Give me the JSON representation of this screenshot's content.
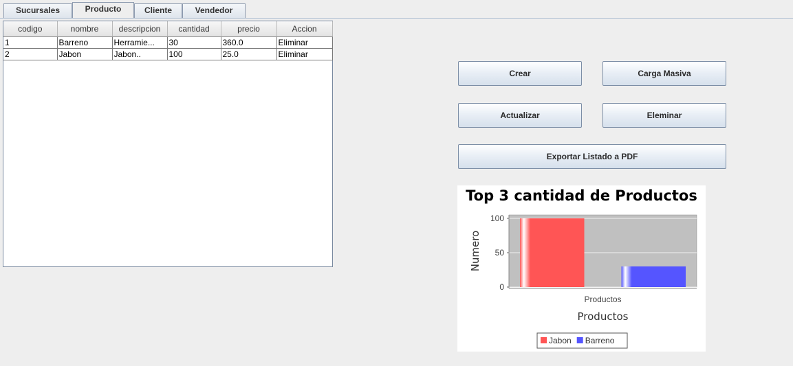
{
  "tabs": [
    {
      "label": "Sucursales",
      "active": false
    },
    {
      "label": "Producto",
      "active": true
    },
    {
      "label": "Cliente",
      "active": false
    },
    {
      "label": "Vendedor",
      "active": false
    }
  ],
  "table": {
    "columns": [
      "codigo",
      "nombre",
      "descripcion",
      "cantidad",
      "precio",
      "Accion"
    ],
    "rows": [
      [
        "1",
        "Barreno",
        "Herramie...",
        "30",
        "360.0",
        "Eliminar"
      ],
      [
        "2",
        "Jabon",
        "Jabon..",
        "100",
        "25.0",
        "Eliminar"
      ]
    ]
  },
  "buttons": {
    "crear": "Crear",
    "carga_masiva": "Carga Masiva",
    "actualizar": "Actualizar",
    "eliminar": "Eleminar",
    "exportar": "Exportar Listado a PDF"
  },
  "chart_data": {
    "type": "bar",
    "title": "Top 3 cantidad de Productos",
    "xlabel": "Productos",
    "ylabel": "Numero",
    "categories": [
      "Productos"
    ],
    "series": [
      {
        "name": "Jabon",
        "values": [
          100
        ],
        "color": "#ff5555"
      },
      {
        "name": "Barreno",
        "values": [
          30
        ],
        "color": "#5555ff"
      }
    ],
    "ylim": [
      0,
      105
    ],
    "yticks": [
      0,
      50,
      100
    ],
    "grid": true,
    "legend": "bottom",
    "plot_background": "#c0c0c0"
  }
}
